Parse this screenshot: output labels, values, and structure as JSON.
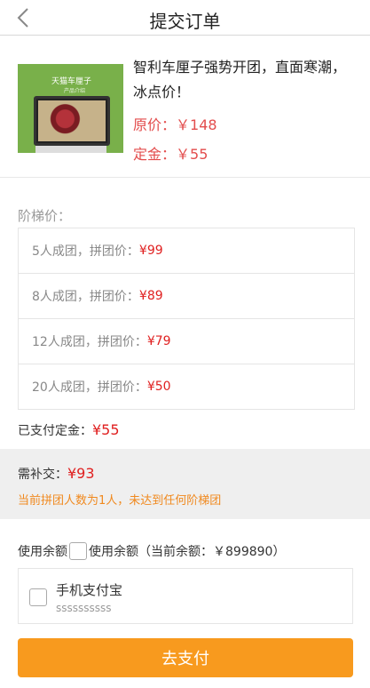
{
  "header": {
    "title": "提交订单",
    "back_icon": "chevron-left-icon"
  },
  "product": {
    "image_text_main": "天猫车厘子",
    "image_text_sub": "产品介绍",
    "title": "智利车厘子强势开团，直面寒潮，冰点价！",
    "original_price_label": "原价：",
    "original_price": "￥148",
    "deposit_label": "定金：",
    "deposit": "￥55"
  },
  "tiers": {
    "label": "阶梯价：",
    "rows": [
      {
        "condition": "5人成团，拼团价：",
        "price": "¥99"
      },
      {
        "condition": "8人成团，拼团价：",
        "price": "¥89"
      },
      {
        "condition": "12人成团，拼团价：",
        "price": "¥79"
      },
      {
        "condition": "20人成团，拼团价：",
        "price": "¥50"
      }
    ]
  },
  "paid": {
    "label": "已支付定金：",
    "value": "¥55"
  },
  "need": {
    "label": "需补交：",
    "value": "¥93",
    "note": "当前拼团人数为1人，未达到任何阶梯团"
  },
  "balance": {
    "prefix": "使用余额",
    "label": "使用余额（当前余额：￥899890）",
    "checked": false
  },
  "payment": {
    "name": "手机支付宝",
    "desc": "ssssssssss",
    "checked": false
  },
  "submit": {
    "label": "去支付"
  },
  "colors": {
    "accent": "#f89a1e",
    "price": "#e02020",
    "note": "#f0891e"
  }
}
